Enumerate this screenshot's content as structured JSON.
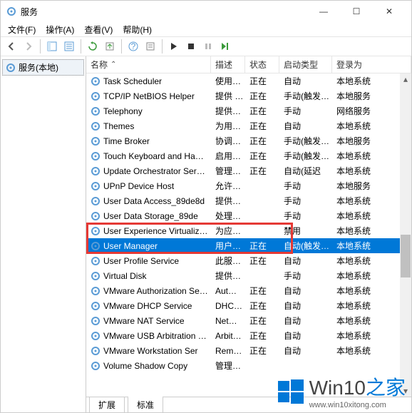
{
  "window": {
    "title": "服务",
    "min": "—",
    "max": "☐",
    "close": "✕"
  },
  "menu": {
    "file": "文件(F)",
    "action": "操作(A)",
    "view": "查看(V)",
    "help": "帮助(H)"
  },
  "leftpane": {
    "item": "服务(本地)"
  },
  "columns": {
    "name": "名称",
    "desc": "描述",
    "status": "状态",
    "startup": "启动类型",
    "logon": "登录为",
    "sort_indicator": "⌃"
  },
  "rows": [
    {
      "name": "Task Scheduler",
      "desc": "使用…",
      "status": "正在",
      "startup": "自动",
      "logon": "本地系统"
    },
    {
      "name": "TCP/IP NetBIOS Helper",
      "desc": "提供 …",
      "status": "正在",
      "startup": "手动(触发…",
      "logon": "本地服务"
    },
    {
      "name": "Telephony",
      "desc": "提供…",
      "status": "正在",
      "startup": "手动",
      "logon": "网络服务"
    },
    {
      "name": "Themes",
      "desc": "为用…",
      "status": "正在",
      "startup": "自动",
      "logon": "本地系统"
    },
    {
      "name": "Time Broker",
      "desc": "协调…",
      "status": "正在",
      "startup": "手动(触发…",
      "logon": "本地服务"
    },
    {
      "name": "Touch Keyboard and Ha…",
      "desc": "启用…",
      "status": "正在",
      "startup": "手动(触发…",
      "logon": "本地系统"
    },
    {
      "name": "Update Orchestrator Ser…",
      "desc": "管理…",
      "status": "正在",
      "startup": "自动(延迟",
      "logon": "本地系统"
    },
    {
      "name": "UPnP Device Host",
      "desc": "允许…",
      "status": "",
      "startup": "手动",
      "logon": "本地服务"
    },
    {
      "name": "User Data Access_89de8d",
      "desc": "提供…",
      "status": "",
      "startup": "手动",
      "logon": "本地系统"
    },
    {
      "name": "User Data Storage_89de",
      "desc": "处理…",
      "status": "",
      "startup": "手动",
      "logon": "本地系统"
    },
    {
      "name": "User Experience Virtualiz…",
      "desc": "为应…",
      "status": "",
      "startup": "禁用",
      "logon": "本地系统"
    },
    {
      "name": "User Manager",
      "desc": "用户…",
      "status": "正在",
      "startup": "自动(触发…",
      "logon": "本地系统",
      "selected": true,
      "highlighted": true
    },
    {
      "name": "User Profile Service",
      "desc": "此服…",
      "status": "正在",
      "startup": "自动",
      "logon": "本地系统"
    },
    {
      "name": "Virtual Disk",
      "desc": "提供…",
      "status": "",
      "startup": "手动",
      "logon": "本地系统"
    },
    {
      "name": "VMware Authorization Se…",
      "desc": "Aut…",
      "status": "正在",
      "startup": "自动",
      "logon": "本地系统"
    },
    {
      "name": "VMware DHCP Service",
      "desc": "DHC…",
      "status": "正在",
      "startup": "自动",
      "logon": "本地系统"
    },
    {
      "name": "VMware NAT Service",
      "desc": "Net…",
      "status": "正在",
      "startup": "自动",
      "logon": "本地系统"
    },
    {
      "name": "VMware USB Arbitration …",
      "desc": "Arbit…",
      "status": "正在",
      "startup": "自动",
      "logon": "本地系统"
    },
    {
      "name": "VMware Workstation Ser",
      "desc": "Rem…",
      "status": "正在",
      "startup": "自动",
      "logon": "本地系统"
    },
    {
      "name": "Volume Shadow Copy",
      "desc": "管理…",
      "status": "",
      "startup": "",
      "logon": ""
    }
  ],
  "tabs": {
    "extended": "扩展",
    "standard": "标准"
  },
  "watermark": {
    "brand": "Win10",
    "suffix": "之家",
    "url": "www.win10xitong.com"
  }
}
